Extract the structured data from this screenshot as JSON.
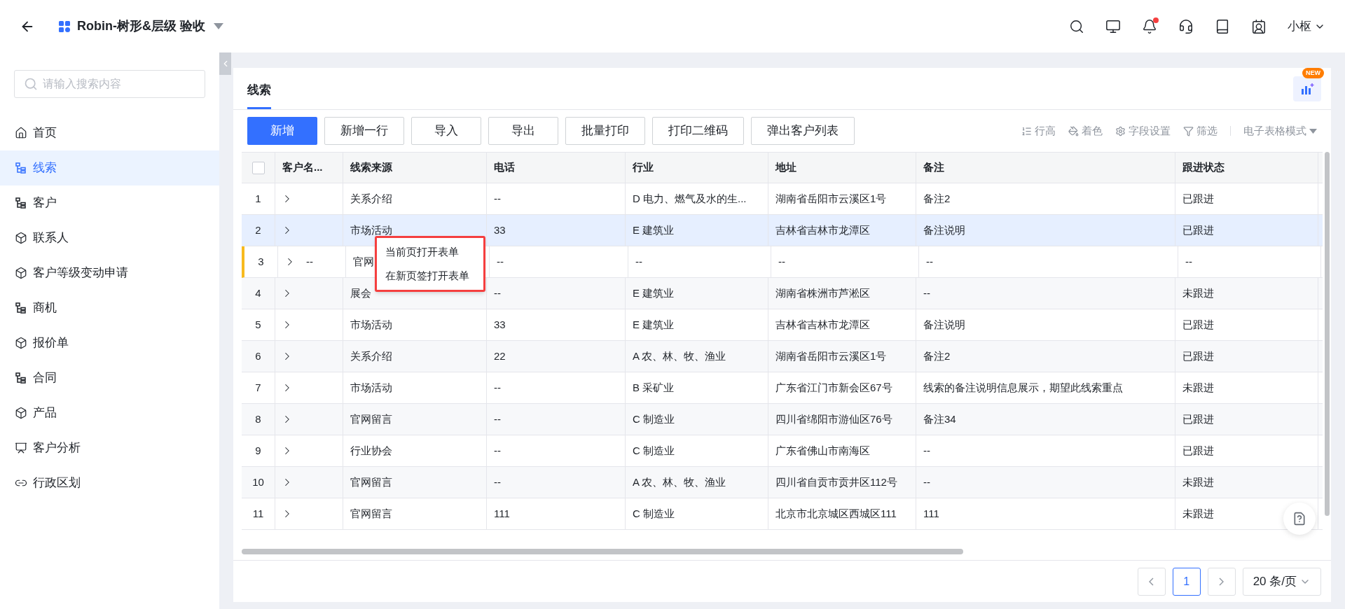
{
  "header": {
    "title": "Robin-树形&层级 验收",
    "has_unread": true,
    "user": "小枢"
  },
  "sidebar": {
    "search": {
      "placeholder": "请输入搜索内容"
    },
    "items": [
      {
        "label": "首页",
        "kind": "home",
        "selected": false
      },
      {
        "label": "线索",
        "kind": "tree",
        "selected": true
      },
      {
        "label": "客户",
        "kind": "tree",
        "selected": false
      },
      {
        "label": "联系人",
        "kind": "cube",
        "selected": false
      },
      {
        "label": "客户等级变动申请",
        "kind": "cube",
        "selected": false
      },
      {
        "label": "商机",
        "kind": "tree",
        "selected": false
      },
      {
        "label": "报价单",
        "kind": "cube",
        "selected": false
      },
      {
        "label": "合同",
        "kind": "tree",
        "selected": false
      },
      {
        "label": "产品",
        "kind": "cube",
        "selected": false
      },
      {
        "label": "客户分析",
        "kind": "chart",
        "selected": false
      },
      {
        "label": "行政区划",
        "kind": "link",
        "selected": false
      }
    ]
  },
  "page": {
    "tab": "线索",
    "new_badge": "NEW",
    "toolbar": [
      {
        "label": "新增",
        "primary": true
      },
      {
        "label": "新增一行",
        "primary": false
      },
      {
        "label": "导入",
        "primary": false
      },
      {
        "label": "导出",
        "primary": false
      },
      {
        "label": "批量打印",
        "primary": false
      },
      {
        "label": "打印二维码",
        "primary": false
      },
      {
        "label": "弹出客户列表",
        "primary": false
      }
    ],
    "tools": [
      "行高",
      "着色",
      "字段设置",
      "筛选"
    ],
    "view_mode": "电子表格模式",
    "table": {
      "columns": [
        {
          "kind": "checkbox",
          "checked": false
        },
        {
          "kind": "text",
          "label": "客户名..."
        },
        {
          "kind": "text",
          "label": "线索来源"
        },
        {
          "kind": "text",
          "label": "电话"
        },
        {
          "kind": "text",
          "label": "行业"
        },
        {
          "kind": "text",
          "label": "地址"
        },
        {
          "kind": "text",
          "label": "备注"
        },
        {
          "kind": "text",
          "label": "跟进状态"
        }
      ],
      "rows": [
        {
          "cells": [
            "1",
            "",
            "关系介绍",
            "--",
            "D 电力、燃气及水的生...",
            "湖南省岳阳市云溪区1号",
            "备注2",
            "已跟进"
          ],
          "selected": false,
          "marked": false
        },
        {
          "cells": [
            "2",
            "",
            "市场活动",
            "33",
            "E 建筑业",
            "吉林省吉林市龙潭区",
            "备注说明",
            "已跟进"
          ],
          "selected": true,
          "marked": false
        },
        {
          "cells": [
            "3",
            "--",
            "官网",
            "--",
            "--",
            "--",
            "--",
            "--"
          ],
          "selected": false,
          "marked": true
        },
        {
          "cells": [
            "4",
            "",
            "展会",
            "--",
            "E 建筑业",
            "湖南省株洲市芦淞区",
            "--",
            "未跟进"
          ],
          "selected": false,
          "marked": false
        },
        {
          "cells": [
            "5",
            "",
            "市场活动",
            "33",
            "E 建筑业",
            "吉林省吉林市龙潭区",
            "备注说明",
            "已跟进"
          ],
          "selected": false,
          "marked": false
        },
        {
          "cells": [
            "6",
            "",
            "关系介绍",
            "22",
            "A 农、林、牧、渔业",
            "湖南省岳阳市云溪区1号",
            "备注2",
            "已跟进"
          ],
          "selected": false,
          "marked": false
        },
        {
          "cells": [
            "7",
            "",
            "市场活动",
            "--",
            "B 采矿业",
            "广东省江门市新会区67号",
            "线索的备注说明信息展示，期望此线索重点",
            "未跟进"
          ],
          "selected": false,
          "marked": false
        },
        {
          "cells": [
            "8",
            "",
            "官网留言",
            "--",
            "C 制造业",
            "四川省绵阳市游仙区76号",
            "备注34",
            "已跟进"
          ],
          "selected": false,
          "marked": false
        },
        {
          "cells": [
            "9",
            "",
            "行业协会",
            "--",
            "C 制造业",
            "广东省佛山市南海区",
            "--",
            "已跟进"
          ],
          "selected": false,
          "marked": false
        },
        {
          "cells": [
            "10",
            "",
            "官网留言",
            "--",
            "A 农、林、牧、渔业",
            "四川省自贡市贡井区112号",
            "--",
            "未跟进"
          ],
          "selected": false,
          "marked": false
        },
        {
          "cells": [
            "11",
            "",
            "官网留言",
            "111",
            "C 制造业",
            "北京市北京城区西城区111",
            "111",
            "未跟进"
          ],
          "selected": false,
          "marked": false
        }
      ]
    },
    "context_menu": [
      "当前页打开表单",
      "在新页签打开表单"
    ],
    "pagination": {
      "pages": [
        {
          "label": "1",
          "selected": true
        }
      ],
      "page_size": "20 条/页"
    }
  }
}
